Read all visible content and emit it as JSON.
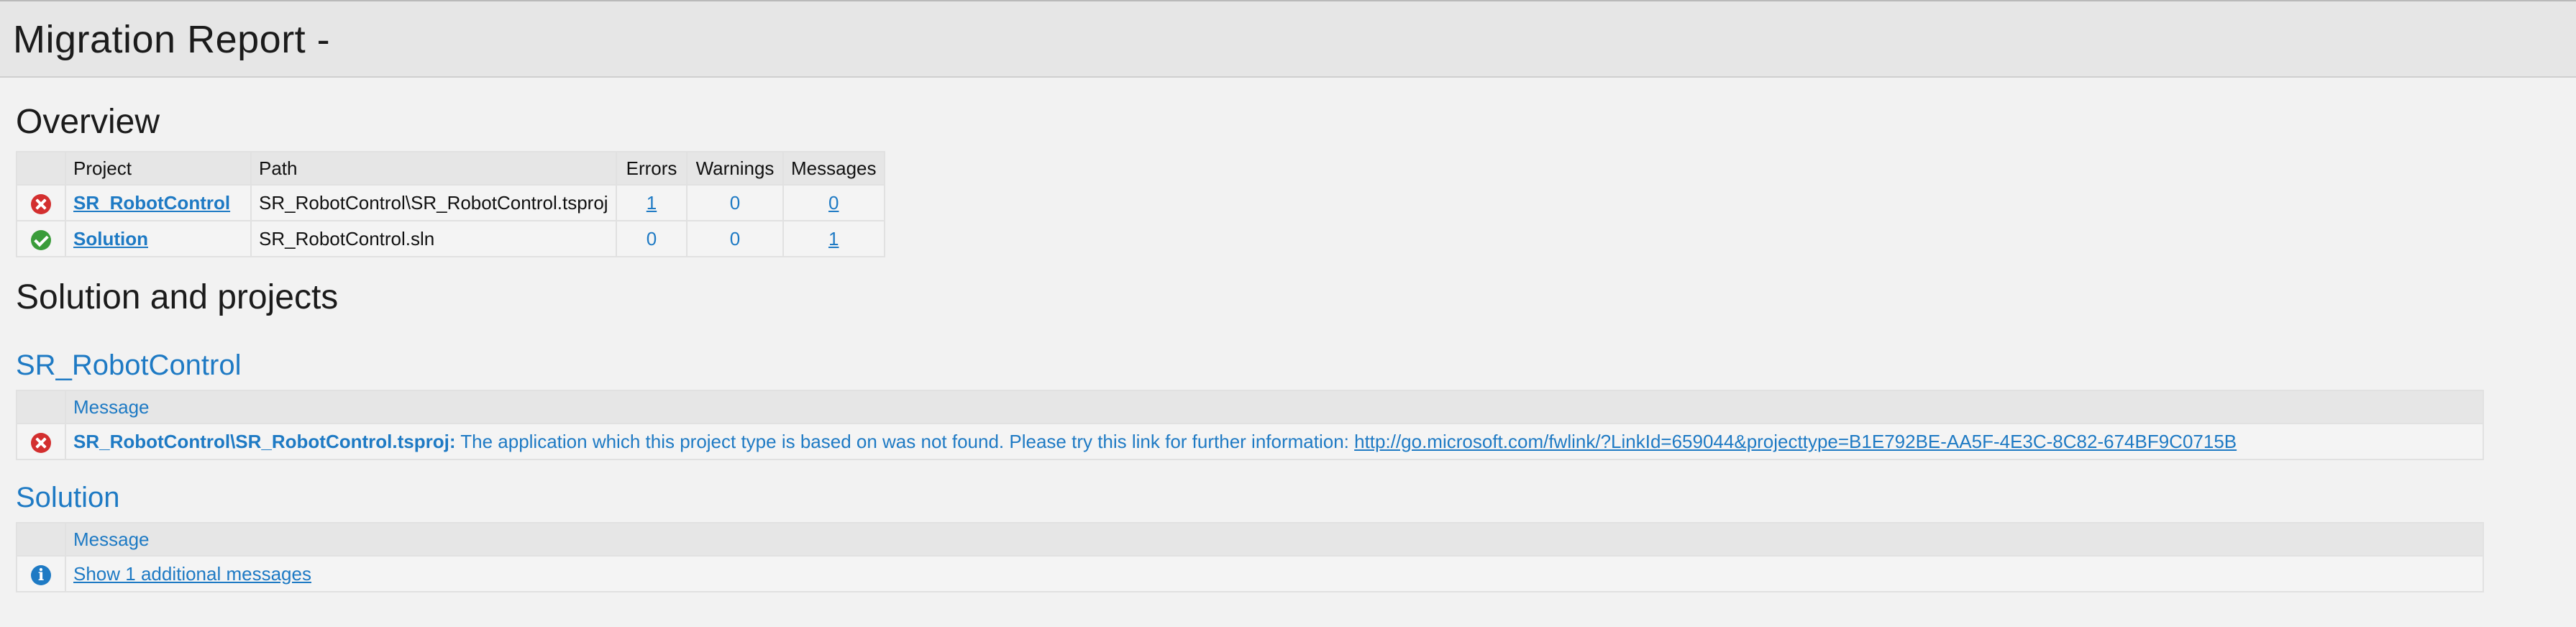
{
  "header": {
    "title": "Migration Report -"
  },
  "overview": {
    "heading": "Overview",
    "columns": [
      "",
      "Project",
      "Path",
      "Errors",
      "Warnings",
      "Messages"
    ],
    "rows": [
      {
        "status": "error",
        "status_icon": "error-icon",
        "project": "SR_RobotControl",
        "path": "SR_RobotControl\\SR_RobotControl.tsproj",
        "errors": "1",
        "warnings": "0",
        "messages": "0"
      },
      {
        "status": "success",
        "status_icon": "success-icon",
        "project": "Solution",
        "path": "SR_RobotControl.sln",
        "errors": "0",
        "warnings": "0",
        "messages": "1"
      }
    ]
  },
  "solution_section": {
    "heading": "Solution and projects"
  },
  "project_sr": {
    "heading": "SR_RobotControl",
    "column_message": "Message",
    "message": {
      "icon": "error-icon",
      "source": "SR_RobotControl\\SR_RobotControl.tsproj:",
      "text": " The application which this project type is based on was not found. Please try this link for further information: ",
      "link": "http://go.microsoft.com/fwlink/?LinkId=659044&projecttype=B1E792BE-AA5F-4E3C-8C82-674BF9C0715B"
    }
  },
  "project_solution": {
    "heading": "Solution",
    "column_message": "Message",
    "message": {
      "icon": "info-icon",
      "link": "Show 1 additional messages"
    }
  },
  "colors": {
    "accent": "#1e7ac4",
    "error": "#d32f2f",
    "success": "#3a9c3a",
    "header_bg": "#e6e6e6",
    "page_bg": "#f2f2f2"
  }
}
